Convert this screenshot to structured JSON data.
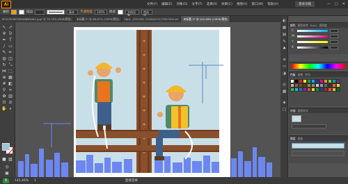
{
  "app": {
    "logo": "Ai"
  },
  "menu": {
    "items": [
      "文件(F)",
      "编辑(E)",
      "对象(O)",
      "文字(T)",
      "选择(S)",
      "效果(C)",
      "视图(V)",
      "窗口(W)",
      "帮助(H)"
    ],
    "workspace": "基本功能",
    "window_controls": [
      "—",
      "□",
      "✕"
    ]
  },
  "controlbar": {
    "tool_label": "编组",
    "stroke_label": "描边",
    "style_label": "基本",
    "opacity_label": "不透明度",
    "opacity_value": "100%",
    "style2_label": "样式",
    "doc_settings": "文档设置",
    "prefs": "首选项"
  },
  "tabs": [
    {
      "label": "8012352BF28046BB5AB1.jpg* @ 33.33% (RGB/预览)",
      "active": false
    },
    {
      "label": "未标题-1* @ 66.67% (CMYK/预览)",
      "active": false
    },
    {
      "label": "h6pt...2551952 20180415173957000.ai*",
      "active": false
    },
    {
      "label": "未标题-1* @ 145.46% (CMYK/预览)",
      "active": true
    }
  ],
  "colors": {
    "accent_orange": "#ff9a00",
    "sky": "#c9dfe8",
    "beam": "#8a4f2c",
    "beam_dark": "#6e3c20",
    "city_blue": "#6d87f0",
    "vest": "#e8741e",
    "helmet": "#f3b72b",
    "skin": "#e8a56b",
    "pants": "#3e5f8a"
  },
  "panels": {
    "color_tabs": [
      "颜色",
      "颜色参考",
      "Kuler",
      "透明度"
    ],
    "slider_labels": [
      "C",
      "M",
      "Y",
      "K"
    ],
    "swatch_tabs": [
      "色板",
      "画笔",
      "符号"
    ],
    "layers_tabs": [
      "图层",
      "画板"
    ],
    "stroke_tabs": [
      "外观",
      "图形样式"
    ]
  },
  "status": {
    "zoom": "145.46%",
    "tool_name": "直接选择",
    "nav_label": "1"
  }
}
